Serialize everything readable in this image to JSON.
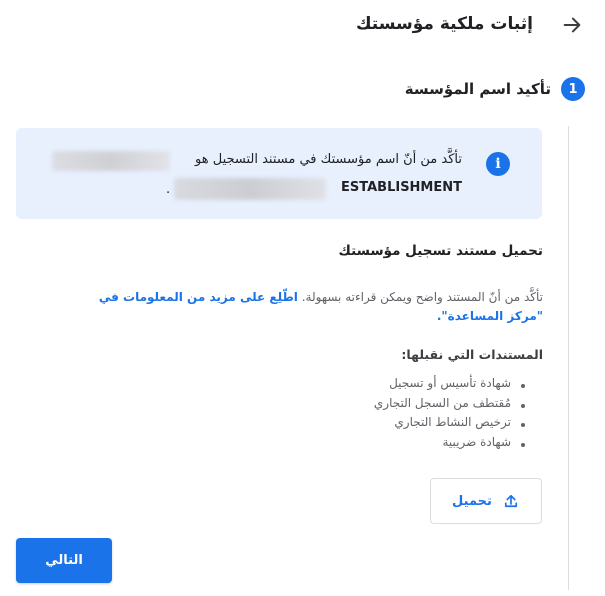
{
  "header": {
    "title": "إثبات ملكية مؤسستك",
    "back_icon": "arrow-back-icon"
  },
  "step": {
    "number": "1",
    "title": "تأكيد اسم المؤسسة"
  },
  "info": {
    "icon": "info-icon",
    "line1": "تأكَّد من أنّ اسم مؤسستك في مستند التسجيل هو",
    "line2": "ESTABLISHMENT"
  },
  "upload_section": {
    "heading": "تحميل مستند تسجيل مؤسستك",
    "hint_text": "تأكَّد من أنّ المستند واضح ويمكن قراءته بسهولة. ",
    "hint_link": "اطّلِع على مزيد من المعلومات في \"مركز المساعدة\".",
    "accepted_heading": "المستندات التي نقبلها:",
    "documents": [
      "شهادة تأسيس أو تسجيل",
      "مُقتطف من السجل التجاري",
      "ترخيص النشاط التجاري",
      "شهادة ضريبية"
    ],
    "upload_label": "تحميل",
    "upload_icon": "upload-icon"
  },
  "footer": {
    "next_label": "التالي"
  },
  "colors": {
    "accent": "#1a73e8",
    "info_bg": "#e8f0fe"
  }
}
